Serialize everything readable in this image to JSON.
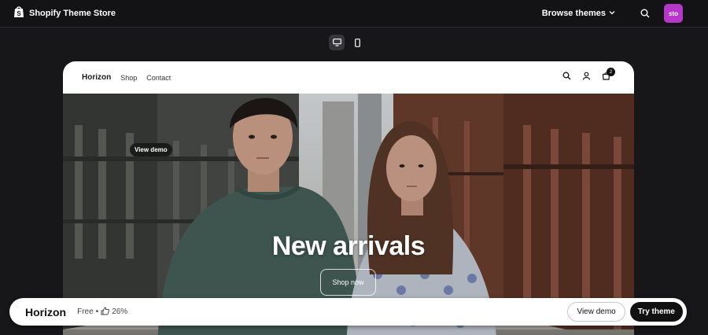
{
  "header": {
    "title": "Shopify Theme Store",
    "browse_label": "Browse themes",
    "avatar_text": "sto",
    "avatar_color": "#b637c9",
    "icons": [
      "shopify-bag-icon",
      "chevron-down-icon",
      "search-icon"
    ]
  },
  "device_toggle": {
    "options": [
      "desktop",
      "mobile"
    ],
    "selected": "desktop"
  },
  "preview": {
    "store_name": "Horizon",
    "nav_links": [
      "Shop",
      "Contact"
    ],
    "cart_count": "2",
    "tooltip": "View demo",
    "hero_title": "New arrivals",
    "hero_button": "Shop now"
  },
  "footer": {
    "theme_name": "Horizon",
    "price": "Free",
    "separator": "•",
    "rating": "26%",
    "view_demo": "View demo",
    "try_theme": "Try theme"
  }
}
